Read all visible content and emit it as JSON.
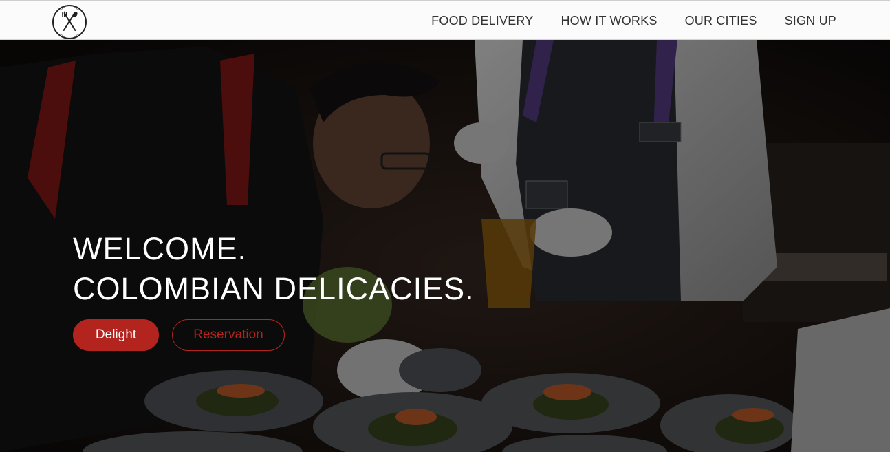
{
  "header": {
    "logo_icon": "fork-and-spoon-icon",
    "nav": [
      {
        "label": "FOOD DELIVERY"
      },
      {
        "label": "HOW IT WORKS"
      },
      {
        "label": "OUR CITIES"
      },
      {
        "label": "SIGN UP"
      }
    ]
  },
  "hero": {
    "line1": "WELCOME.",
    "line2": "COLOMBIAN DELICACIES.",
    "primary_button": "Delight",
    "secondary_button": "Reservation",
    "background_image": "chefs plating dishes in a kitchen"
  },
  "colors": {
    "accent": "#b3241f",
    "nav_text": "#333333",
    "header_bg": "#fbfbfb",
    "headline": "#ffffff"
  }
}
